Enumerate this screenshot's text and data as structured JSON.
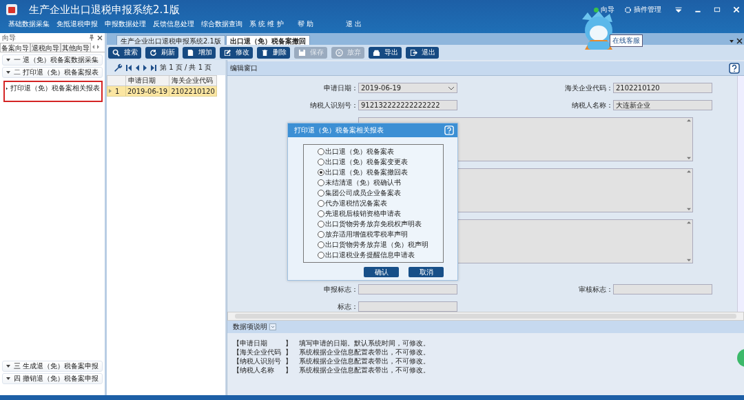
{
  "window": {
    "title": "生产企业出口退税申报系统2.1版",
    "controls": [
      "向导",
      "插件管理"
    ]
  },
  "menu": [
    "基础数据采集",
    "免抵退税申报",
    "申报数据处理",
    "反馈信息处理",
    "综合数据查询",
    "系 统 维 护",
    "帮 助",
    "退 出"
  ],
  "mascot": {
    "tooltip": "在线客服"
  },
  "guide": {
    "title": "向导",
    "tabs": [
      {
        "label": "备案向导",
        "selected": true
      },
      {
        "label": "退税向导",
        "selected": false
      },
      {
        "label": "其他向导",
        "selected": false
      }
    ],
    "sections": [
      {
        "label": "一 退（免）税备案数据采集"
      },
      {
        "label": "二 打印退（免）税备案报表",
        "children": [
          {
            "label": "打印退（免）税备案相关报表",
            "selected": true
          }
        ]
      }
    ],
    "bottom_sections": [
      {
        "label": "三 生成退（免）税备案申报"
      },
      {
        "label": "四 撤销退（免）税备案申报"
      }
    ]
  },
  "doc_tabs": [
    {
      "label": "生产企业出口退税申报系统2.1版",
      "selected": false
    },
    {
      "label": "出口退（免）税备案撤回",
      "selected": true
    }
  ],
  "toolbar": [
    {
      "label": "搜索",
      "kind": "search",
      "disabled": false
    },
    {
      "label": "刷新",
      "kind": "refresh",
      "disabled": false
    },
    {
      "label": "增加",
      "kind": "add",
      "disabled": false
    },
    {
      "label": "修改",
      "kind": "edit",
      "disabled": false
    },
    {
      "label": "删除",
      "kind": "delete",
      "disabled": false
    },
    {
      "label": "保存",
      "kind": "save",
      "disabled": true
    },
    {
      "label": "放弃",
      "kind": "discard",
      "disabled": true
    },
    {
      "label": "导出",
      "kind": "export",
      "disabled": false
    },
    {
      "label": "退出",
      "kind": "exit",
      "disabled": false
    }
  ],
  "pager": {
    "text": "第 1 页 / 共 1 页"
  },
  "list": {
    "columns": [
      "申请日期",
      "海关企业代码"
    ],
    "rows": [
      {
        "index": "1",
        "cells": [
          "2019-06-19",
          "2102210120"
        ],
        "selected": true
      }
    ]
  },
  "editor": {
    "title": "编辑窗口",
    "fields": [
      {
        "kind": "select",
        "label": "申请日期：",
        "value": "2019-06-19"
      },
      {
        "kind": "text",
        "label": "海关企业代码：",
        "value": "2102210120"
      },
      {
        "kind": "text",
        "label": "纳税人识别号：",
        "value": "912132222222222222"
      },
      {
        "kind": "text",
        "label": "纳税人名称：",
        "value": "大连新企业"
      },
      {
        "kind": "textarea"
      },
      {
        "kind": "textarea"
      },
      {
        "kind": "textarea"
      },
      {
        "kind": "text",
        "label": "申报标志："
      },
      {
        "kind": "text",
        "label": "审核标志："
      },
      {
        "kind": "text",
        "label": "标志："
      }
    ]
  },
  "help": {
    "title": "数据项说明",
    "rows": [
      {
        "term": "【申请日期",
        "term_end": "】",
        "text": "填写申请的日期。默认系统时间，可修改。"
      },
      {
        "term": "【海关企业代码",
        "term_end": "】",
        "text": "系统根据企业信息配置表带出，不可修改。"
      },
      {
        "term": "【纳税人识别号",
        "term_end": "】",
        "text": "系统根据企业信息配置表带出，不可修改。"
      },
      {
        "term": "【纳税人名称",
        "term_end": "】",
        "text": "系统根据企业信息配置表带出，不可修改。"
      }
    ]
  },
  "dialog": {
    "title": "打印退（免）税备案相关报表",
    "options": [
      {
        "label": "出口退（免）税备案表",
        "selected": false
      },
      {
        "label": "出口退（免）税备案变更表",
        "selected": false
      },
      {
        "label": "出口退（免）税备案撤回表",
        "selected": true
      },
      {
        "label": "未结清退（免）税确认书",
        "selected": false
      },
      {
        "label": "集团公司成员企业备案表",
        "selected": false
      },
      {
        "label": "代办退税情况备案表",
        "selected": false
      },
      {
        "label": "先退税后核销资格申请表",
        "selected": false
      },
      {
        "label": "出口货物劳务放弃免税权声明表",
        "selected": false
      },
      {
        "label": "放弃适用增值税零税率声明",
        "selected": false
      },
      {
        "label": "出口货物劳务放弃退（免）税声明",
        "selected": false
      },
      {
        "label": "出口退税业务提醒信息申请表",
        "selected": false
      }
    ],
    "buttons": [
      "确认",
      "取消"
    ]
  }
}
